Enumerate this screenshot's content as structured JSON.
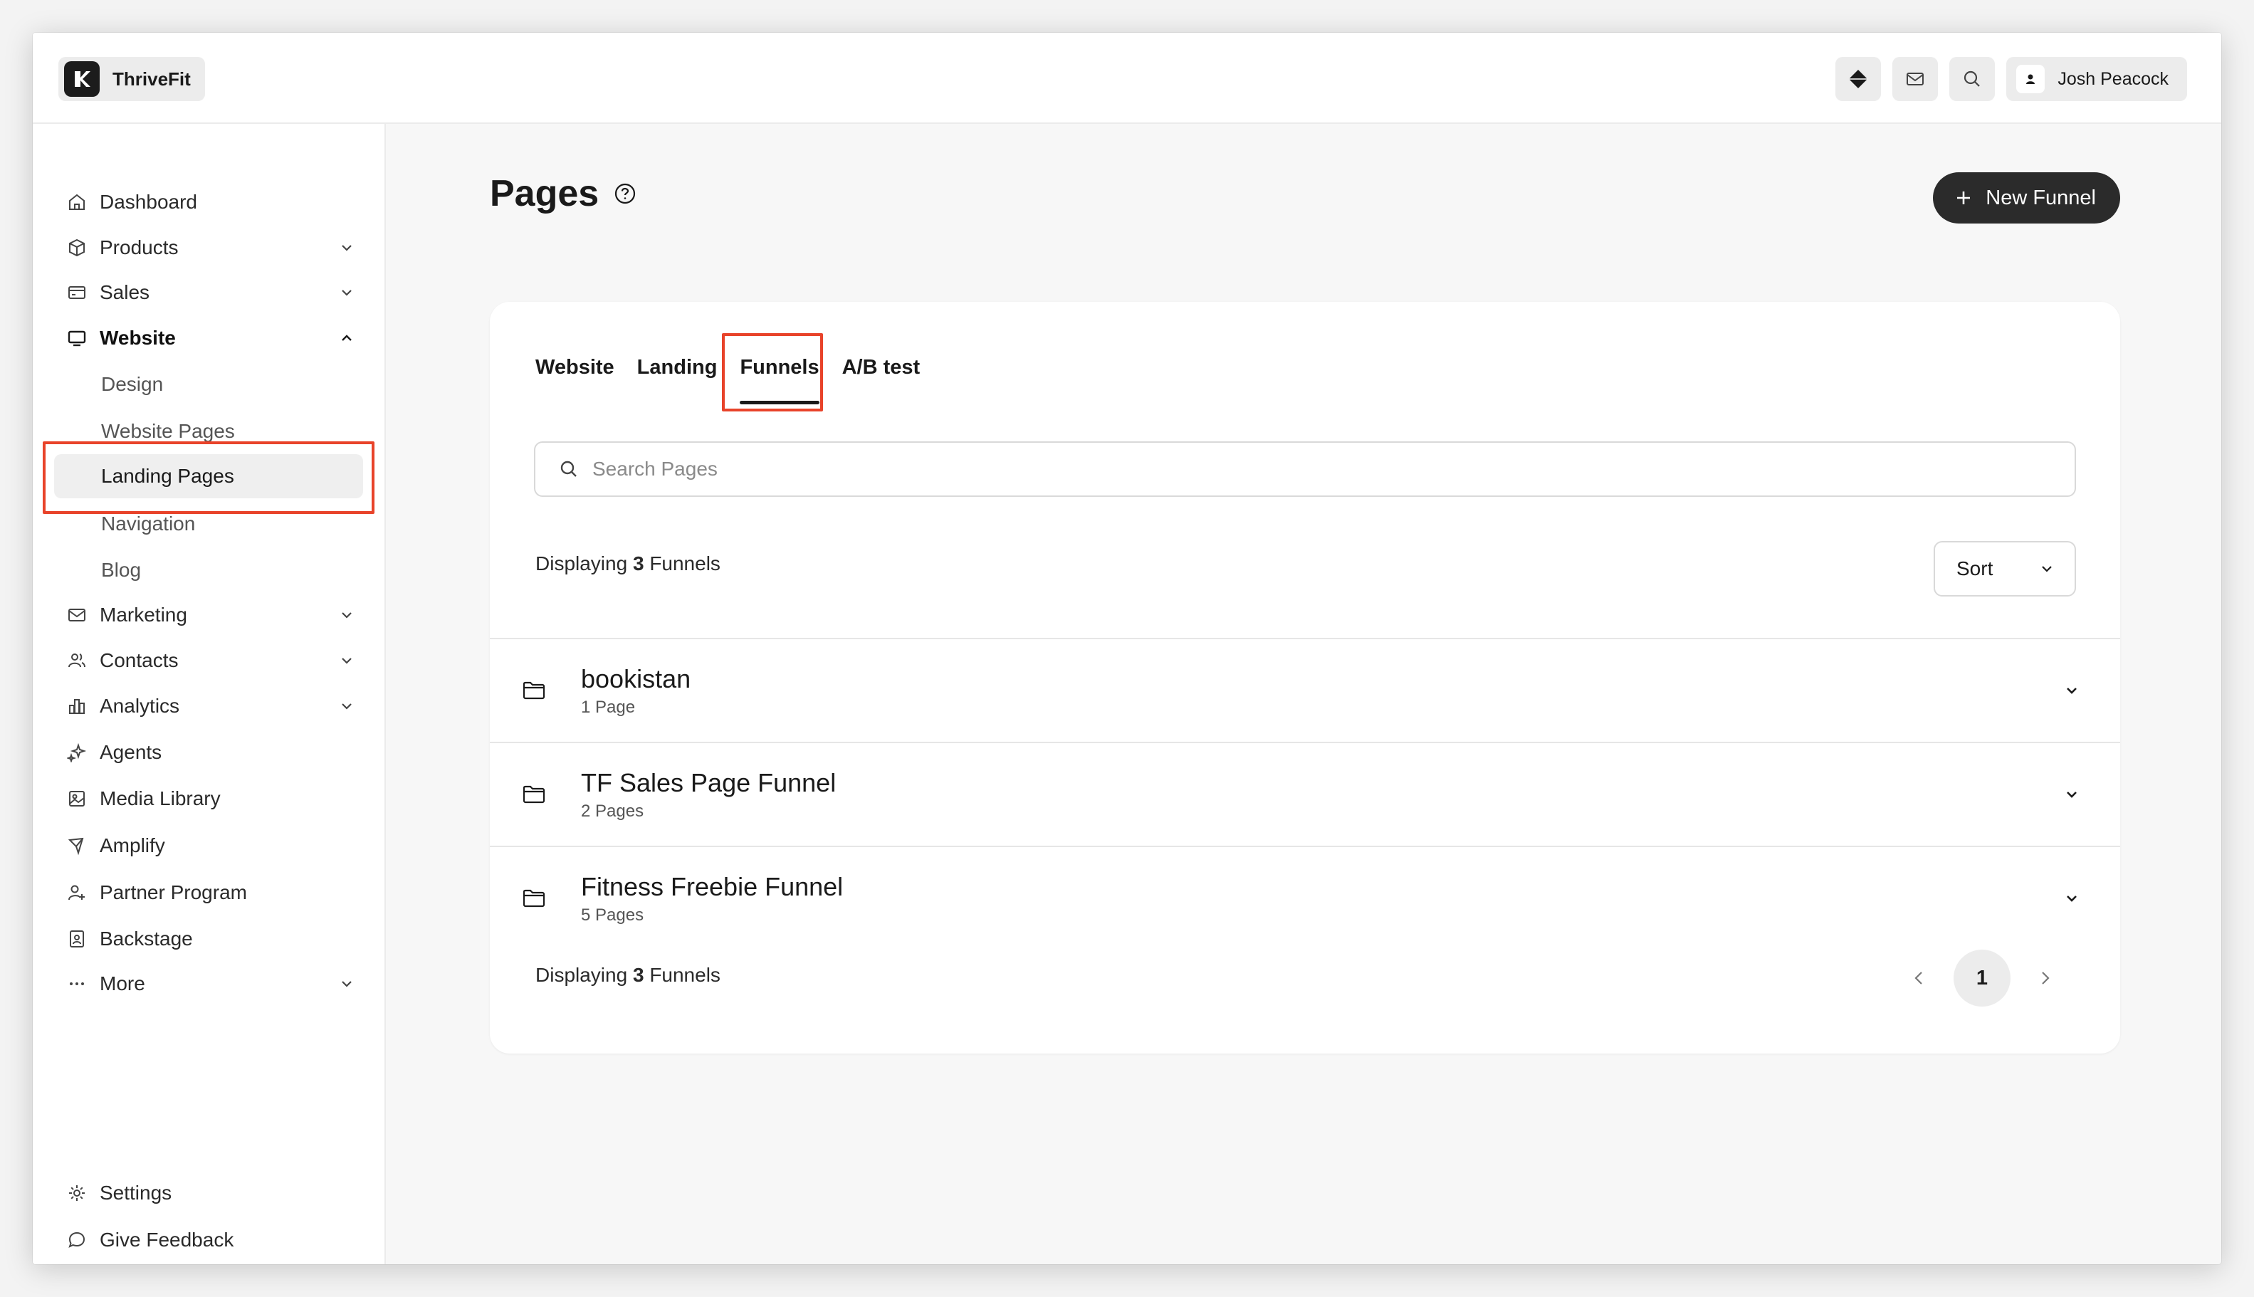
{
  "topbar": {
    "brand_name": "ThriveFit",
    "user_name": "Josh Peacock"
  },
  "sidebar": {
    "items": [
      {
        "label": "Dashboard"
      },
      {
        "label": "Products"
      },
      {
        "label": "Sales"
      },
      {
        "label": "Website"
      },
      {
        "label": "Marketing"
      },
      {
        "label": "Contacts"
      },
      {
        "label": "Analytics"
      },
      {
        "label": "Agents"
      },
      {
        "label": "Media Library"
      },
      {
        "label": "Amplify"
      },
      {
        "label": "Partner Program"
      },
      {
        "label": "Backstage"
      },
      {
        "label": "More"
      }
    ],
    "website_sub": [
      {
        "label": "Design"
      },
      {
        "label": "Website Pages"
      },
      {
        "label": "Landing Pages"
      },
      {
        "label": "Navigation"
      },
      {
        "label": "Blog"
      }
    ],
    "bottom": [
      {
        "label": "Settings"
      },
      {
        "label": "Give Feedback"
      }
    ]
  },
  "main": {
    "title": "Pages",
    "new_funnel_label": "New Funnel",
    "tabs": [
      {
        "label": "Website"
      },
      {
        "label": "Landing"
      },
      {
        "label": "Funnels"
      },
      {
        "label": "A/B test"
      }
    ],
    "search_placeholder": "Search Pages",
    "displaying_prefix": "Displaying",
    "displaying_count": "3",
    "displaying_suffix": "Funnels",
    "sort_label": "Sort",
    "funnels": [
      {
        "name": "bookistan",
        "count": "1 Page"
      },
      {
        "name": "TF Sales Page Funnel",
        "count": "2 Pages"
      },
      {
        "name": "Fitness Freebie Funnel",
        "count": "5 Pages"
      }
    ],
    "current_page": "1"
  },
  "colors": {
    "highlight": "#e8432a",
    "primary_button": "#2b2b2b"
  }
}
